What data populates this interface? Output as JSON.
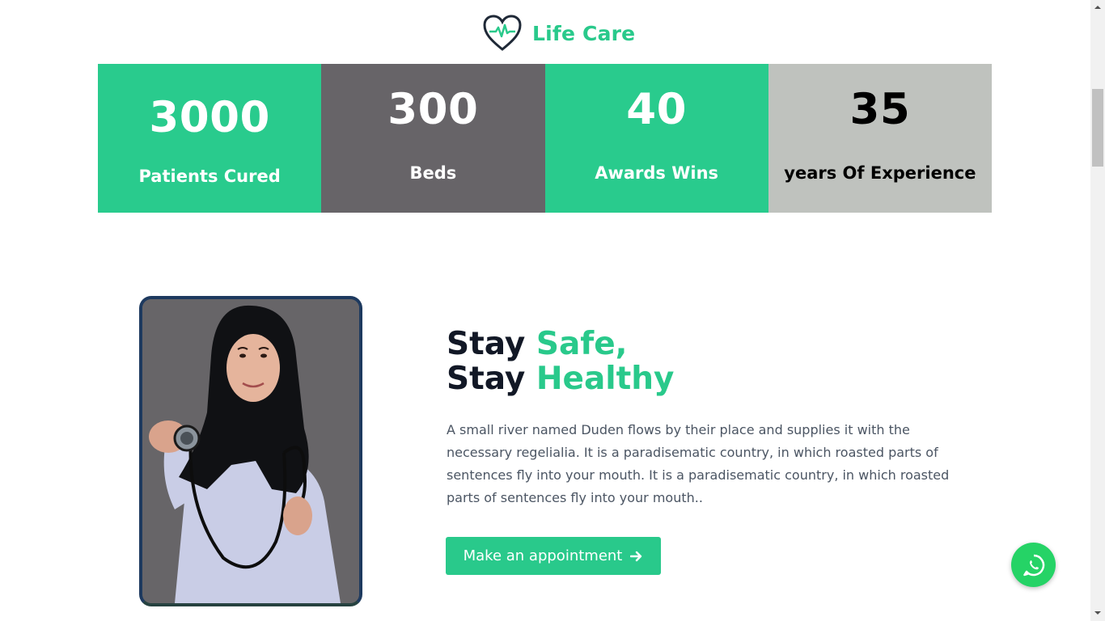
{
  "brand": {
    "name": "Life Care",
    "color": "#29c98b",
    "icon": "heart-pulse-icon"
  },
  "stats": [
    {
      "value": "3000",
      "label": "Patients Cured",
      "bg": "#29cb8d",
      "text_color": "#ffffff"
    },
    {
      "value": "300",
      "label": "Beds",
      "bg": "#676468",
      "text_color": "#ffffff"
    },
    {
      "value": "40",
      "label": "Awards Wins",
      "bg": "#29cb8d",
      "text_color": "#ffffff"
    },
    {
      "value": "35",
      "label": "years Of Experience",
      "bg": "#bfc2be",
      "text_color": "#000000"
    }
  ],
  "hero": {
    "line1_prefix": "Stay",
    "line1_accent": "Safe,",
    "line2_prefix": "Stay",
    "line2_accent": "Healthy",
    "description": "A small river named Duden flows by their place and supplies it with the necessary regelialia. It is a paradisematic country, in which roasted parts of sentences fly into your mouth. It is a paradisematic country, in which roasted parts of sentences fly into your mouth..",
    "cta_label": "Make an appointment",
    "cta_icon": "arrow-right-icon"
  },
  "floating": {
    "whatsapp_icon": "whatsapp-icon",
    "color": "#25d366"
  }
}
